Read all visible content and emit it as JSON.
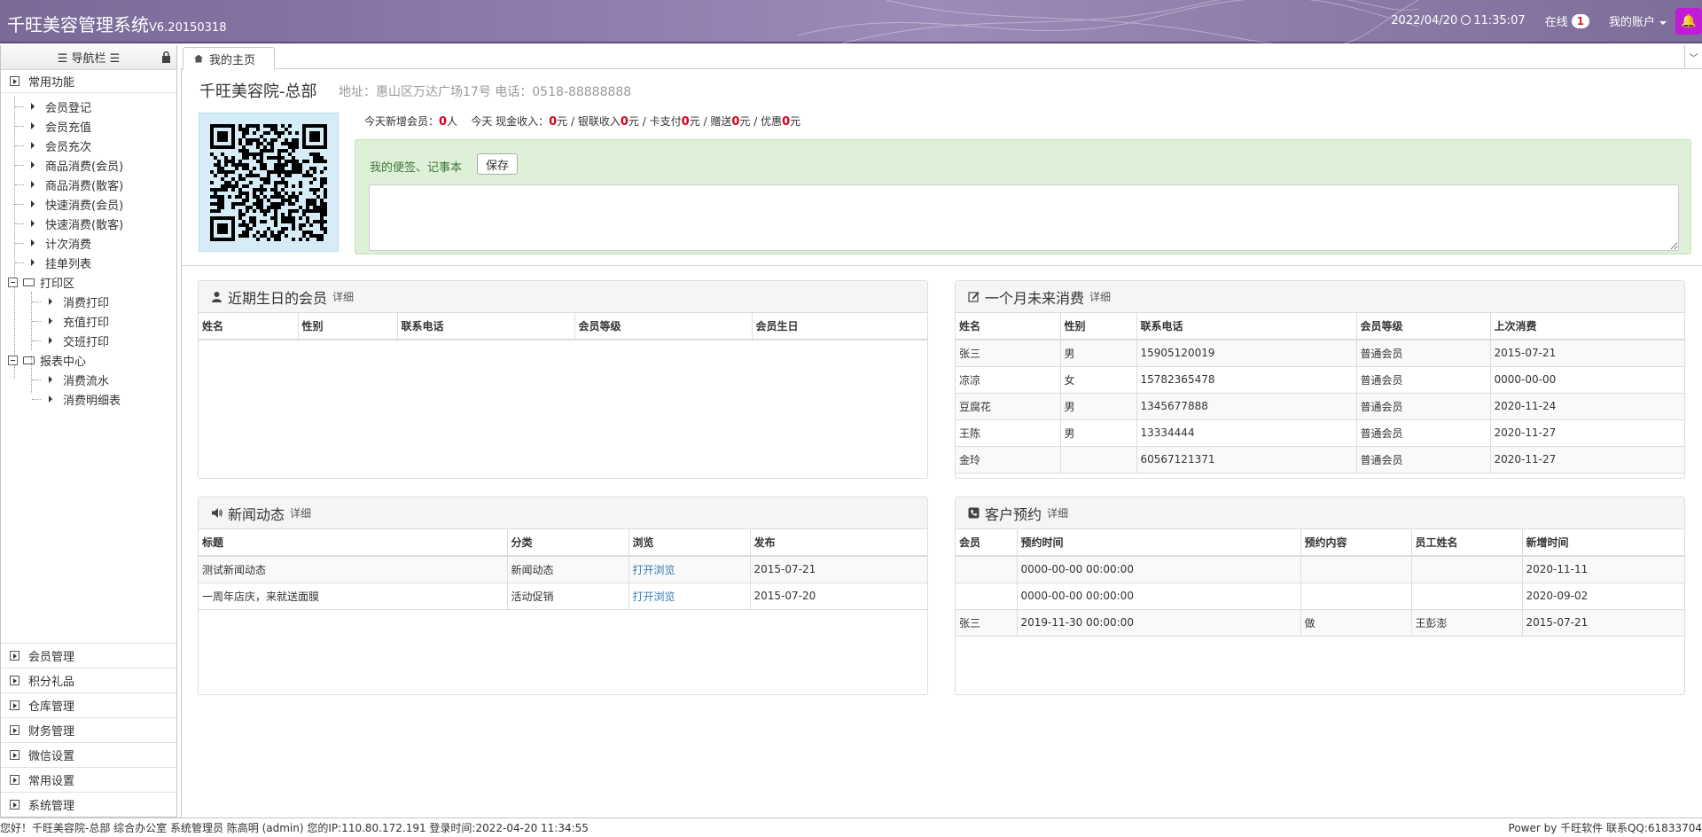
{
  "header": {
    "app_title": "千旺美容管理系统",
    "version": "V6.20150318",
    "datetime_date": "2022/04/20",
    "datetime_time": "11:35:07",
    "online_label": "在线",
    "online_count": "1",
    "account_label": "我的账户"
  },
  "sidebar": {
    "nav_title": "☰ 导航栏 ☰",
    "section_common": "常用功能",
    "common_items": [
      "会员登记",
      "会员充值",
      "会员充次",
      "商品消费(会员)",
      "商品消费(散客)",
      "快速消费(会员)",
      "快速消费(散客)",
      "计次消费",
      "挂单列表"
    ],
    "folder_print": "打印区",
    "print_items": [
      "消费打印",
      "充值打印",
      "交班打印"
    ],
    "folder_report": "报表中心",
    "report_items": [
      "消费流水",
      "消费明细表"
    ],
    "bottom_sections": [
      "会员管理",
      "积分礼品",
      "仓库管理",
      "财务管理",
      "微信设置",
      "常用设置",
      "系统管理"
    ]
  },
  "tabs": {
    "home": "我的主页"
  },
  "store": {
    "name": "千旺美容院-总部",
    "address": "地址：惠山区万达广场17号 电话：0518-88888888"
  },
  "today": {
    "new_member_label": "今天新增会员：",
    "new_member_value": "0",
    "new_member_unit": "人",
    "cash_label": "今天 现金收入：",
    "cash_value": "0",
    "unionpay_label": "元 / 银联收入",
    "unionpay_value": "0",
    "card_label": "元 / 卡支付",
    "card_value": "0",
    "gift_label": "元 / 赠送",
    "gift_value": "0",
    "discount_label": "元 / 优惠",
    "discount_value": "0",
    "end_unit": "元"
  },
  "memo": {
    "label": "我的便签、记事本",
    "save_label": "保存"
  },
  "birthday": {
    "title": "近期生日的会员",
    "more": "详细",
    "columns": [
      "姓名",
      "性别",
      "联系电话",
      "会员等级",
      "会员生日"
    ],
    "rows": []
  },
  "no_consume": {
    "title": "一个月未来消费",
    "more": "详细",
    "columns": [
      "姓名",
      "性别",
      "联系电话",
      "会员等级",
      "上次消费"
    ],
    "rows": [
      [
        "张三",
        "男",
        "15905120019",
        "普通会员",
        "2015-07-21"
      ],
      [
        "凉凉",
        "女",
        "15782365478",
        "普通会员",
        "0000-00-00"
      ],
      [
        "豆腐花",
        "男",
        "1345677888",
        "普通会员",
        "2020-11-24"
      ],
      [
        "王陈",
        "男",
        "13334444",
        "普通会员",
        "2020-11-27"
      ],
      [
        "金玲",
        "",
        "60567121371",
        "普通会员",
        "2020-11-27"
      ]
    ]
  },
  "news": {
    "title": "新闻动态",
    "more": "详细",
    "columns": [
      "标题",
      "分类",
      "浏览",
      "发布"
    ],
    "rows": [
      [
        "测试新闻动态",
        "新闻动态",
        "打开浏览",
        "2015-07-21"
      ],
      [
        "一周年店庆，来就送面膜",
        "活动促销",
        "打开浏览",
        "2015-07-20"
      ]
    ]
  },
  "appointments": {
    "title": "客户预约",
    "more": "详细",
    "columns": [
      "会员",
      "预约时间",
      "预约内容",
      "员工姓名",
      "新增时间"
    ],
    "rows": [
      [
        "",
        "0000-00-00 00:00:00",
        "",
        "",
        "2020-11-11"
      ],
      [
        "",
        "0000-00-00 00:00:00",
        "",
        "",
        "2020-09-02"
      ],
      [
        "张三",
        "2019-11-30 00:00:00",
        "做",
        "王彭澎",
        "2015-07-21"
      ]
    ]
  },
  "statusbar": {
    "left": "您好！千旺美容院-总部 综合办公室 系统管理员 陈高明 (admin) 您的IP:110.80.172.191 登录时间:2022-04-20 11:34:55",
    "right": "Power by 千旺软件 联系QQ:61833704"
  }
}
